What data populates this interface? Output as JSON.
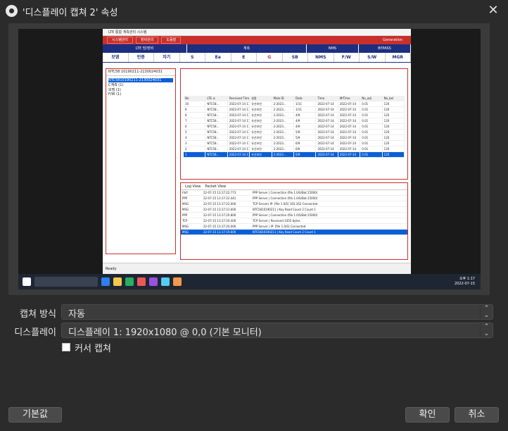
{
  "window": {
    "title": "'디스플레이 캡쳐 2' 속성",
    "close_glyph": "✕"
  },
  "preview": {
    "app_title": "LTE 통합 계측관리 시스템",
    "menu": [
      "시스템관리",
      "장비관리",
      "도움말"
    ],
    "generation_label": "Generation",
    "groups": [
      "LTE 망/장비",
      "계측",
      "NMS",
      "BYPASS"
    ],
    "icons": [
      "모뎀",
      "인증",
      "자기",
      "S",
      "Ea",
      "E",
      "G",
      "SB",
      "NMS",
      "F/W",
      "S/W",
      "MGR"
    ],
    "tree_header": "NTC58 10190211-2130024031",
    "tree_items": [
      "NTC5810190211-2130024031",
      "C계측 (1)",
      "모뎀 (1)",
      "F/W (1)"
    ],
    "table_headers": [
      "No",
      "LTE 쇼",
      "Received Time",
      "설명",
      "Male ID",
      "Data",
      "Time",
      "M/Time",
      "No_adj",
      "No_bol"
    ],
    "table_rows": [
      [
        "10",
        "NTC58...",
        "2022-07-14 17:30:18",
        "유선보안",
        "2-2023...",
        "1/11",
        "2022-07-14",
        "2022-07-14",
        "0.01",
        "120"
      ],
      [
        "9",
        "NTC58...",
        "2022-07-14 17:30:18",
        "유선보안",
        "2-2023...",
        "1/11",
        "2022-07-14",
        "2022-07-14",
        "0.01",
        "120"
      ],
      [
        "8",
        "NTC58...",
        "2022-07-14 17:30:18",
        "유선보안",
        "2-2023...",
        "4/9",
        "2022-07-14",
        "2022-07-14",
        "0.01",
        "120"
      ],
      [
        "7",
        "NTC58...",
        "2022-07-14 17:30:18",
        "유선보안",
        "2-2023...",
        "4/9",
        "2022-07-14",
        "2022-07-14",
        "0.01",
        "120"
      ],
      [
        "6",
        "NTC58...",
        "2022-07-14 17:30:18",
        "유선보안",
        "2-2023...",
        "4/9",
        "2022-07-14",
        "2022-07-14",
        "0.01",
        "120"
      ],
      [
        "5",
        "NTC58...",
        "2022-07-14 17:30:18",
        "유선보안",
        "2-2023...",
        "5/9",
        "2022-07-14",
        "2022-07-14",
        "0.01",
        "120"
      ],
      [
        "4",
        "NTC58...",
        "2022-07-14 17:30:18",
        "유선보안",
        "2-2023...",
        "5/9",
        "2022-07-14",
        "2022-07-14",
        "0.01",
        "120"
      ],
      [
        "3",
        "NTC58...",
        "2022-07-14 17:30:18",
        "유선보안",
        "2-2023...",
        "6/9",
        "2022-07-14",
        "2022-07-14",
        "0.01",
        "120"
      ],
      [
        "2",
        "NTC58...",
        "2022-07-14 17:30:18",
        "유선보안",
        "2-2023...",
        "6/9",
        "2022-07-14",
        "2022-07-14",
        "0.01",
        "120"
      ],
      [
        "1",
        "NTC58...",
        "2022-07-14 17:30:18",
        "유선보안",
        "2-2023...",
        "6/9",
        "2022-07-14",
        "2022-07-14",
        "0.01",
        "120"
      ]
    ],
    "log_tabs": [
      "Log View",
      "Packet View"
    ],
    "log_rows": [
      [
        "F&P",
        "22-07-15 13:17:22.773",
        "PPP Server | Connection (file 1.0/S/Bat:15000)"
      ],
      [
        "PPP",
        "22-07-15 13:17:22.441",
        "PPP Server | Connection (file 1.0/S/Bat:15000)"
      ],
      [
        "MSG",
        "22-07-15 13:17:22.000",
        "TCP Server) IP: [file 1.0/S] 102.162 Connected"
      ],
      [
        "MSG",
        "22-07-15 13:17:21.600",
        "NTC5810190211 | Key Read Count 2 Count 1"
      ],
      [
        "PPP",
        "22-07-15 13:17:20.800",
        "PPP Server | Connection (file 1.0/S/Bat:15000)"
      ],
      [
        "TCP",
        "22-07-15 13:17:20.400",
        "TCP Server | Received 1055 bytes"
      ],
      [
        "MSG",
        "22-07-15 13:17:20.000",
        "PPP Server | IP: [file 1.0/S] Connected"
      ],
      [
        "MSG",
        "22-07-15 13:17:19.600",
        "NTC5810190211 | Key Read Count 2 Count 1"
      ]
    ],
    "status_text": "Ready",
    "clock": {
      "time": "오후 1:17",
      "date": "2022-07-15"
    }
  },
  "form": {
    "capture_method_label": "캡쳐 방식",
    "capture_method_value": "자동",
    "display_label": "디스플레이",
    "display_value": "디스플레이 1: 1920x1080 @ 0,0 (기본 모니터)",
    "cursor_capture_label": "커서 캡쳐",
    "cursor_capture_checked": true
  },
  "buttons": {
    "defaults": "기본값",
    "ok": "확인",
    "cancel": "취소"
  },
  "colors": {
    "dialog_bg": "#2b2b2b",
    "accent_red": "#c9302c",
    "accent_navy": "#1c2e80",
    "selection_blue": "#0a5fd8"
  }
}
